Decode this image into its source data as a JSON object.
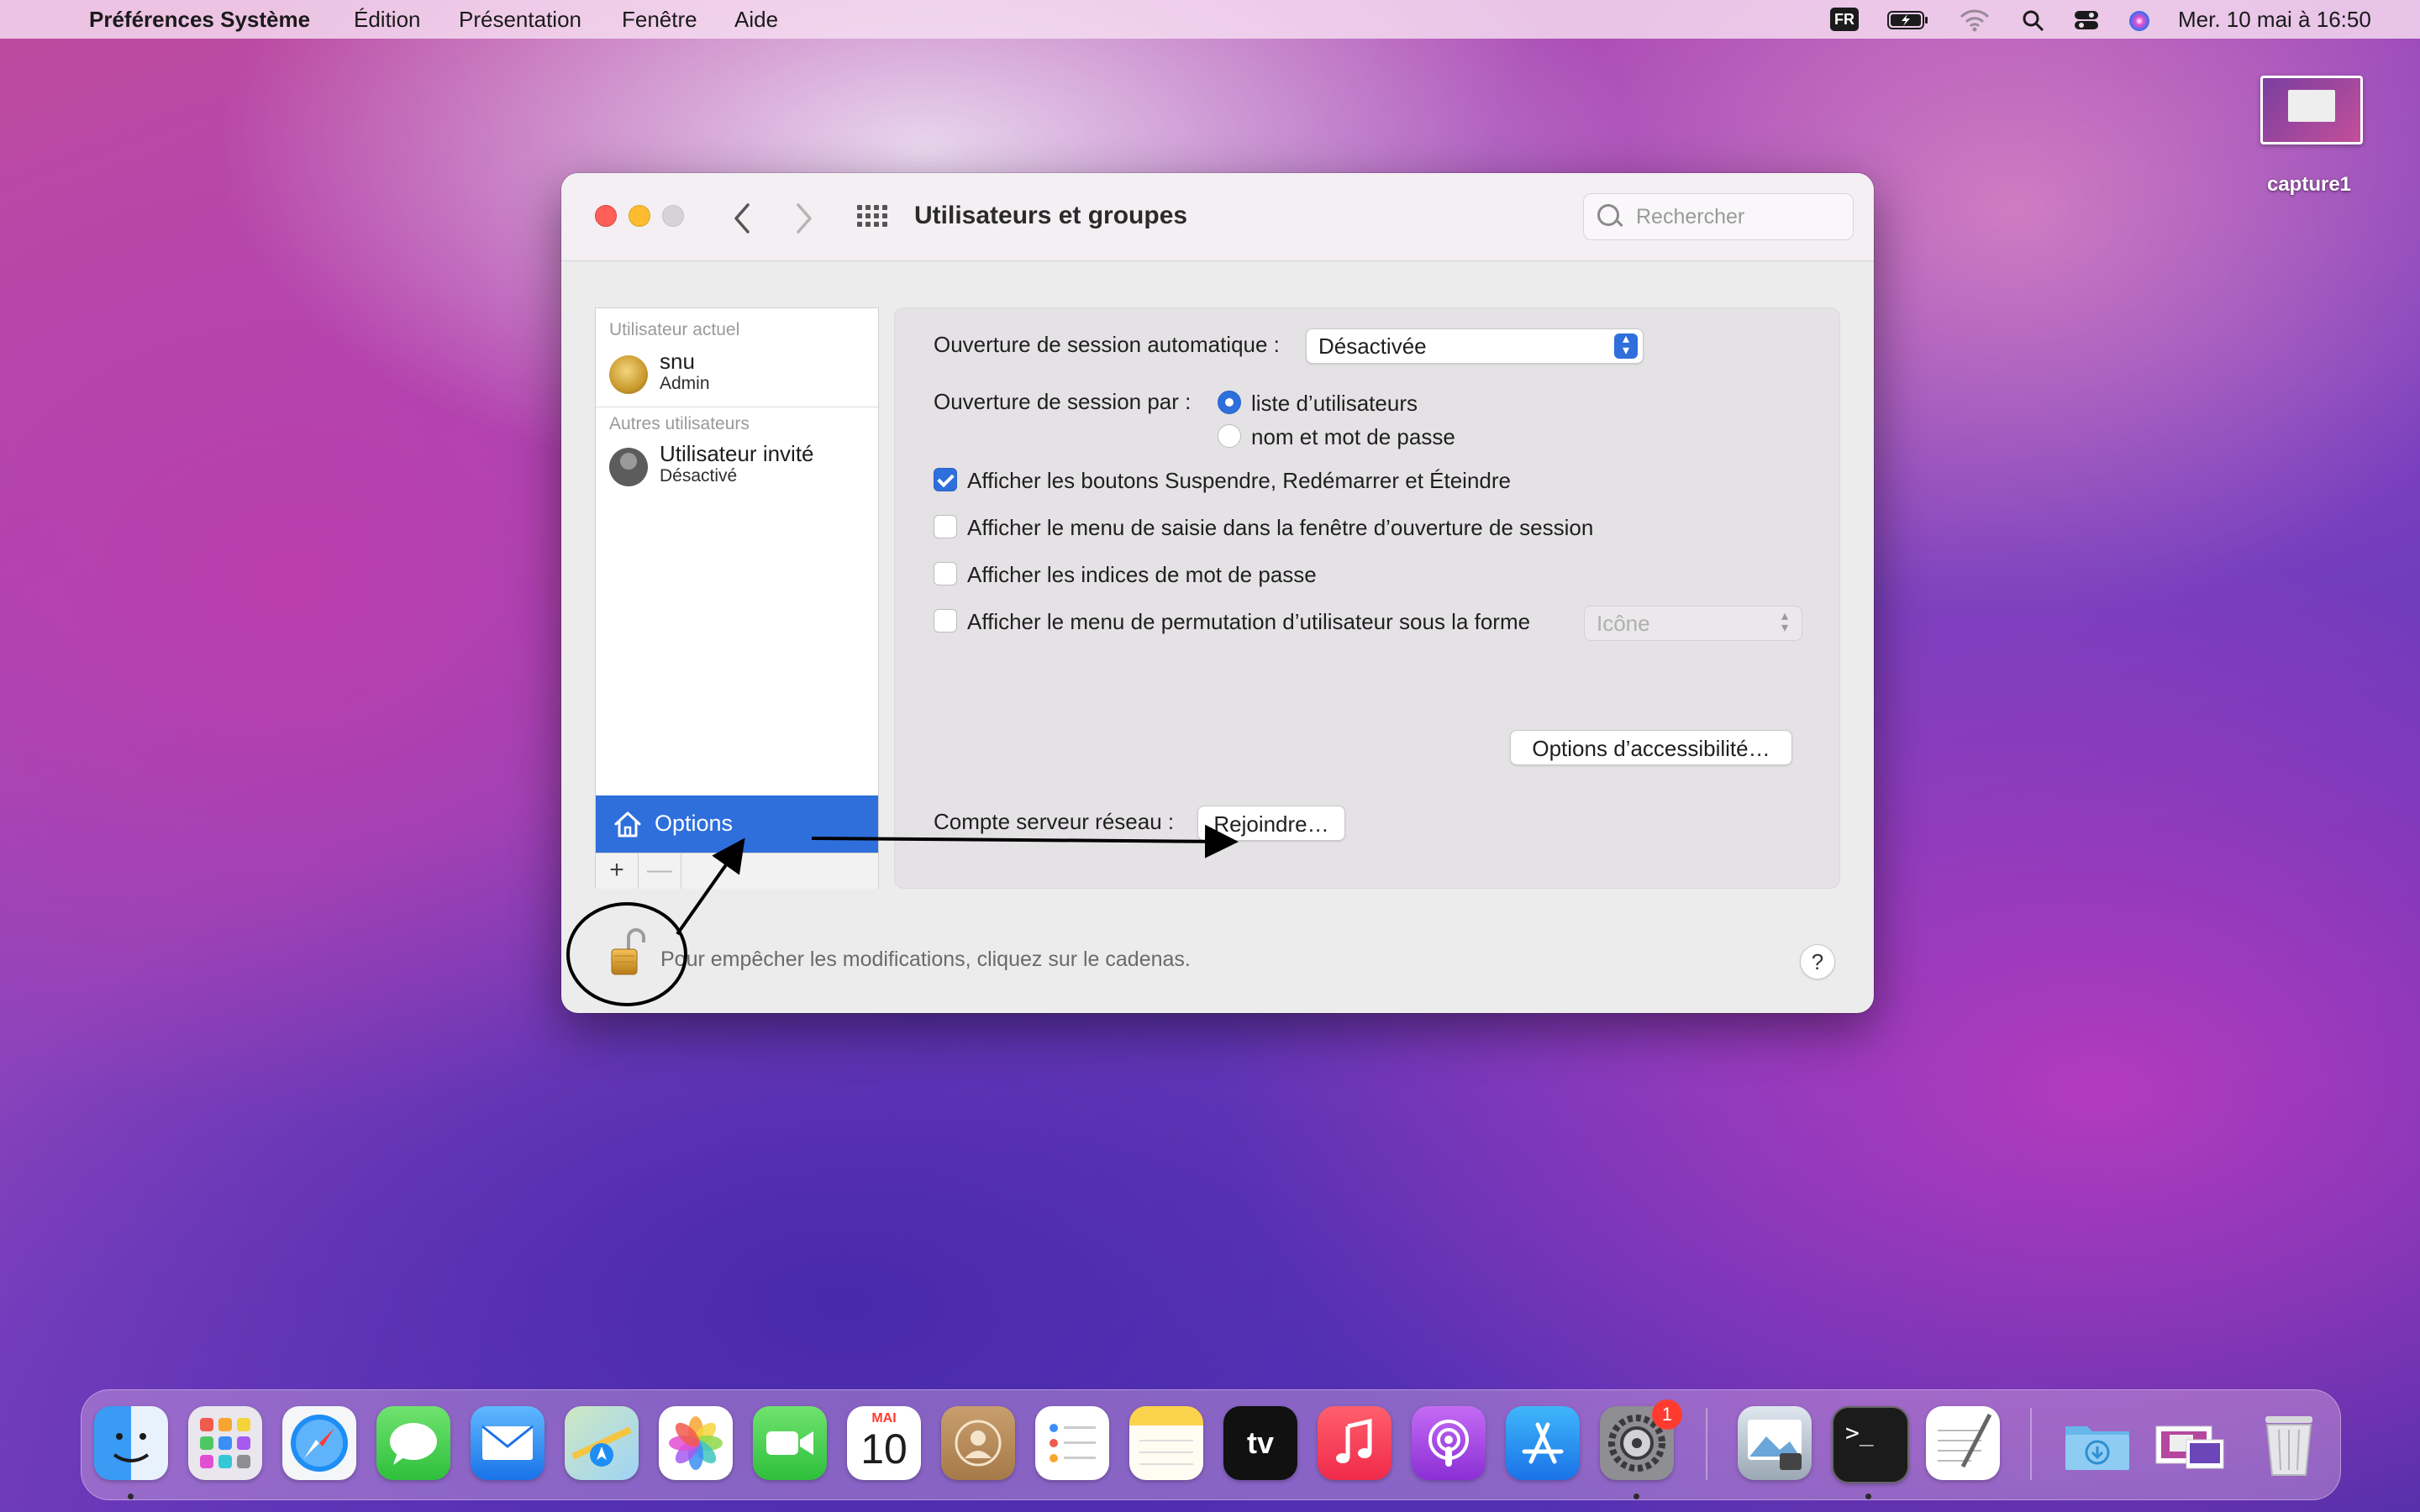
{
  "menubar": {
    "app_name": "Préférences Système",
    "items": [
      "Édition",
      "Présentation",
      "Fenêtre",
      "Aide"
    ],
    "input_source": "FR",
    "clock": "Mer. 10 mai à  16:50"
  },
  "desktop": {
    "file_label": "capture1"
  },
  "window": {
    "title": "Utilisateurs et groupes",
    "search_placeholder": "Rechercher",
    "users": {
      "current_section": "Utilisateur actuel",
      "current_user": {
        "name": "snu",
        "role": "Admin"
      },
      "others_section": "Autres utilisateurs",
      "other_users": [
        {
          "name": "Utilisateur invité",
          "role": "Désactivé"
        }
      ],
      "options_label": "Options",
      "add_label": "+",
      "remove_label": "—"
    },
    "login": {
      "auto_label": "Ouverture de session automatique :",
      "auto_value": "Désactivée",
      "by_label": "Ouverture de session par :",
      "radio_options": [
        {
          "label": "liste d’utilisateurs",
          "selected": true
        },
        {
          "label": "nom et mot de passe",
          "selected": false
        }
      ],
      "checkboxes": [
        {
          "label": "Afficher les boutons Suspendre, Redémarrer et Éteindre",
          "checked": true
        },
        {
          "label": "Afficher le menu de saisie dans la fenêtre d’ouverture de session",
          "checked": false
        },
        {
          "label": "Afficher les indices de mot de passe",
          "checked": false
        },
        {
          "label": "Afficher le menu de permutation d’utilisateur sous la forme",
          "checked": false
        }
      ],
      "switch_menu_value": "Icône",
      "accessibility_button": "Options d’accessibilité…",
      "network_label": "Compte serveur réseau :",
      "join_button": "Rejoindre…"
    },
    "lock_text": "Pour empêcher les modifications, cliquez sur le cadenas.",
    "help_label": "?"
  },
  "dock": {
    "calendar_month": "MAI",
    "calendar_day": "10",
    "settings_badge": "1",
    "apps": [
      "Finder",
      "Launchpad",
      "Safari",
      "Messages",
      "Mail",
      "Plans",
      "Photos",
      "FaceTime",
      "Calendrier",
      "Contacts",
      "Rappels",
      "Notes",
      "TV",
      "Musique",
      "Podcasts",
      "App Store",
      "Préférences Système",
      "Aperçu",
      "Terminal",
      "TextEdit",
      "Téléchargements",
      "Capture",
      "Corbeille"
    ]
  },
  "colors": {
    "accent": "#2e6fdc",
    "badge": "#ff3b30"
  }
}
